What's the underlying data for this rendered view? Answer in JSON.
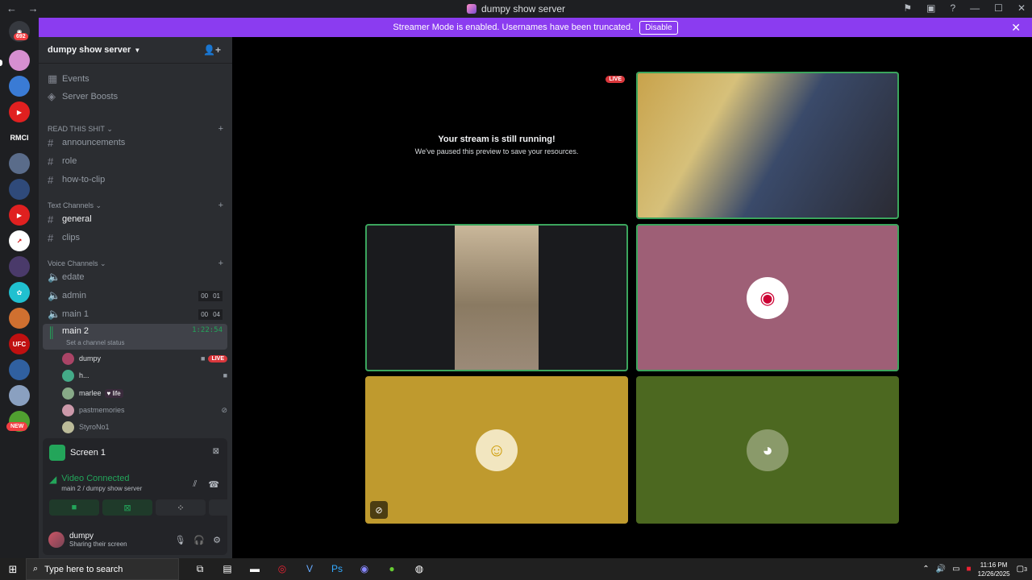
{
  "titlebar": {
    "title": "dumpy show server",
    "back": "←",
    "forward": "→"
  },
  "rail": {
    "dm_badge": "692",
    "new_badge": "NEW",
    "rmcl_label": "RMCI"
  },
  "banner": {
    "text": "Streamer Mode is enabled. Usernames have been truncated.",
    "button": "Disable"
  },
  "server": {
    "name": "dumpy show server"
  },
  "channels": {
    "events": "Events",
    "boosts": "Server Boosts",
    "cat1": "READ THIS SHIT",
    "announcements": "announcements",
    "role": "role",
    "howtoclip": "how-to-clip",
    "cat2": "Text Channels",
    "general": "general",
    "clips": "clips",
    "cat3": "Voice Channels",
    "edate": "edate",
    "admin": "admin",
    "admin_counts": [
      "00",
      "01"
    ],
    "main1": "main 1",
    "main1_counts": [
      "00",
      "04"
    ],
    "main2": "main 2",
    "main2_timer": "1:22:54",
    "main2_status": "Set a channel status"
  },
  "voice_users": [
    {
      "name": "dumpy",
      "live": "LIVE"
    },
    {
      "name": "h..."
    },
    {
      "name": "marlee",
      "tag": "life"
    },
    {
      "name": "pastmemories"
    },
    {
      "name": "StyroNo1"
    }
  ],
  "panel": {
    "screen_title": "Screen 1",
    "vc_title": "Video Connected",
    "vc_sub": "main 2 / dumpy show server"
  },
  "user": {
    "name": "dumpy",
    "status": "Sharing their screen"
  },
  "stage": {
    "paused_title": "Your stream is still running!",
    "paused_sub": "We've paused this preview to save your resources.",
    "live_badge": "LIVE"
  },
  "taskbar": {
    "search_placeholder": "Type here to search",
    "time": "11:16 PM",
    "date": "12/26/2025",
    "notifications": "3"
  },
  "colors": {
    "accent_green": "#23a55a",
    "banner_purple": "#8b3cf0",
    "live_red": "#da373c"
  }
}
